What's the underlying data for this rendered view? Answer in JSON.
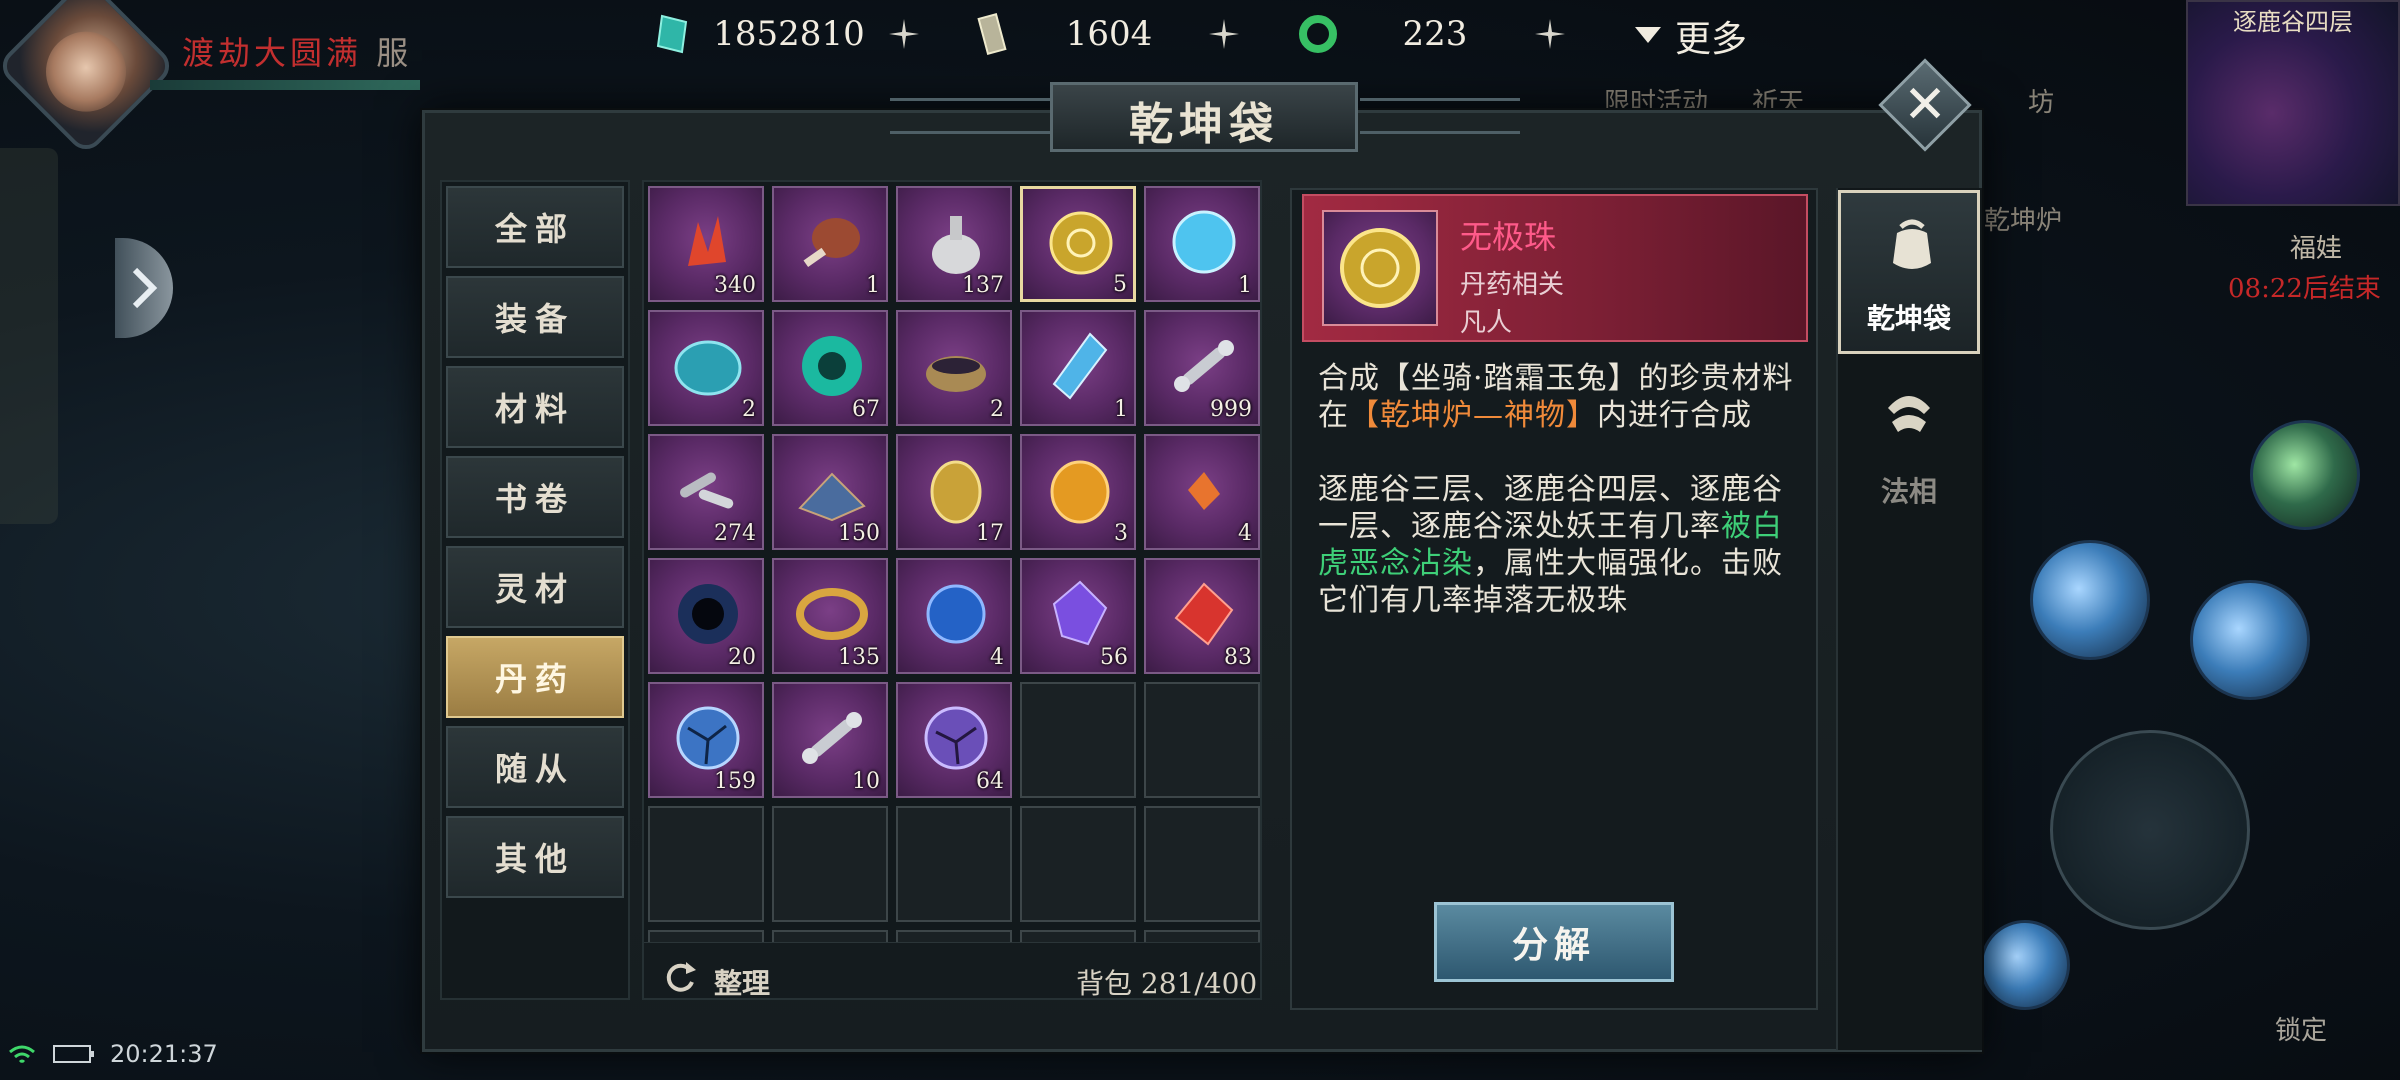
{
  "currencies": [
    {
      "icon": "jade-crystal-icon",
      "value": "1852810"
    },
    {
      "icon": "talisman-token-icon",
      "value": "1604"
    },
    {
      "icon": "jade-ring-icon",
      "value": "223"
    }
  ],
  "top_more_label": "更多",
  "player": {
    "realm": "渡劫大圆满",
    "server_tag": "服"
  },
  "minimap": {
    "location": "逐鹿谷四层"
  },
  "event": {
    "name": "福娃",
    "countdown": "08:22后结束"
  },
  "hud": {
    "lock_label": "锁定",
    "ghost_labels": [
      "限时活动",
      "祈天",
      "坊",
      "乾坤炉"
    ]
  },
  "status_bar": {
    "time": "20:21:37"
  },
  "panel": {
    "title": "乾坤袋",
    "close_icon": "close-icon"
  },
  "categories": [
    {
      "label": "全部",
      "active": false
    },
    {
      "label": "装备",
      "active": false
    },
    {
      "label": "材料",
      "active": false
    },
    {
      "label": "书卷",
      "active": false
    },
    {
      "label": "灵材",
      "active": false
    },
    {
      "label": "丹药",
      "active": true
    },
    {
      "label": "随从",
      "active": false
    },
    {
      "label": "其他",
      "active": false
    }
  ],
  "items": [
    {
      "icon": "red-coral-icon",
      "count": "340"
    },
    {
      "icon": "meat-leg-icon",
      "count": "1"
    },
    {
      "icon": "potion-gourd-icon",
      "count": "137"
    },
    {
      "icon": "golden-orb-icon",
      "count": "5",
      "selected": true
    },
    {
      "icon": "ice-orb-icon",
      "count": "1"
    },
    {
      "icon": "cyan-stone-icon",
      "count": "2"
    },
    {
      "icon": "spirit-swirl-icon",
      "count": "67"
    },
    {
      "icon": "alchemy-cauldron-icon",
      "count": "2"
    },
    {
      "icon": "crystal-vial-icon",
      "count": "1"
    },
    {
      "icon": "bone-icon",
      "count": "999"
    },
    {
      "icon": "bone-fragments-icon",
      "count": "274"
    },
    {
      "icon": "powder-pile-icon",
      "count": "150"
    },
    {
      "icon": "golden-scarab-icon",
      "count": "17"
    },
    {
      "icon": "amber-stone-icon",
      "count": "3"
    },
    {
      "icon": "orange-shards-icon",
      "count": "4"
    },
    {
      "icon": "dark-portal-icon",
      "count": "20"
    },
    {
      "icon": "golden-ring-icon",
      "count": "135"
    },
    {
      "icon": "blue-orb-icon",
      "count": "4"
    },
    {
      "icon": "purple-crystal-icon",
      "count": "56"
    },
    {
      "icon": "red-gem-icon",
      "count": "83"
    },
    {
      "icon": "cracked-blue-orb-icon",
      "count": "159"
    },
    {
      "icon": "bone-icon",
      "count": "10"
    },
    {
      "icon": "cracked-purple-orb-icon",
      "count": "64"
    }
  ],
  "grid_footer": {
    "sort_label": "整理",
    "bag_label": "背包",
    "bag_capacity": "281/400"
  },
  "detail": {
    "name": "无极珠",
    "type": "丹药相关",
    "grade": "凡人",
    "desc_line1": "合成【坐骑·踏霜玉兔】的珍贵材料",
    "desc_line2_prefix": "在",
    "desc_line2_highlight": "【乾坤炉—神物】",
    "desc_line2_suffix": "内进行合成",
    "desc_para2": "逐鹿谷三层、逐鹿谷四层、逐鹿谷一层、逐鹿谷深处妖王有几率",
    "desc_para2_highlight": "被白虎恶念沾染",
    "desc_para2_suffix": "，属性大幅强化。击败它们有几率掉落无极珠",
    "action_label": "分解"
  },
  "side_tabs": [
    {
      "label": "乾坤袋",
      "icon": "pouch-icon",
      "active": true
    },
    {
      "label": "法相",
      "icon": "dharma-icon",
      "active": false
    }
  ],
  "colors": {
    "accent_gold": "#c6a765",
    "rarity_red": "#a22a42",
    "item_name_pink": "#ff5a8a",
    "highlight_orange": "#f08a3a",
    "highlight_green": "#3ecf78",
    "countdown_red": "#c62828"
  }
}
